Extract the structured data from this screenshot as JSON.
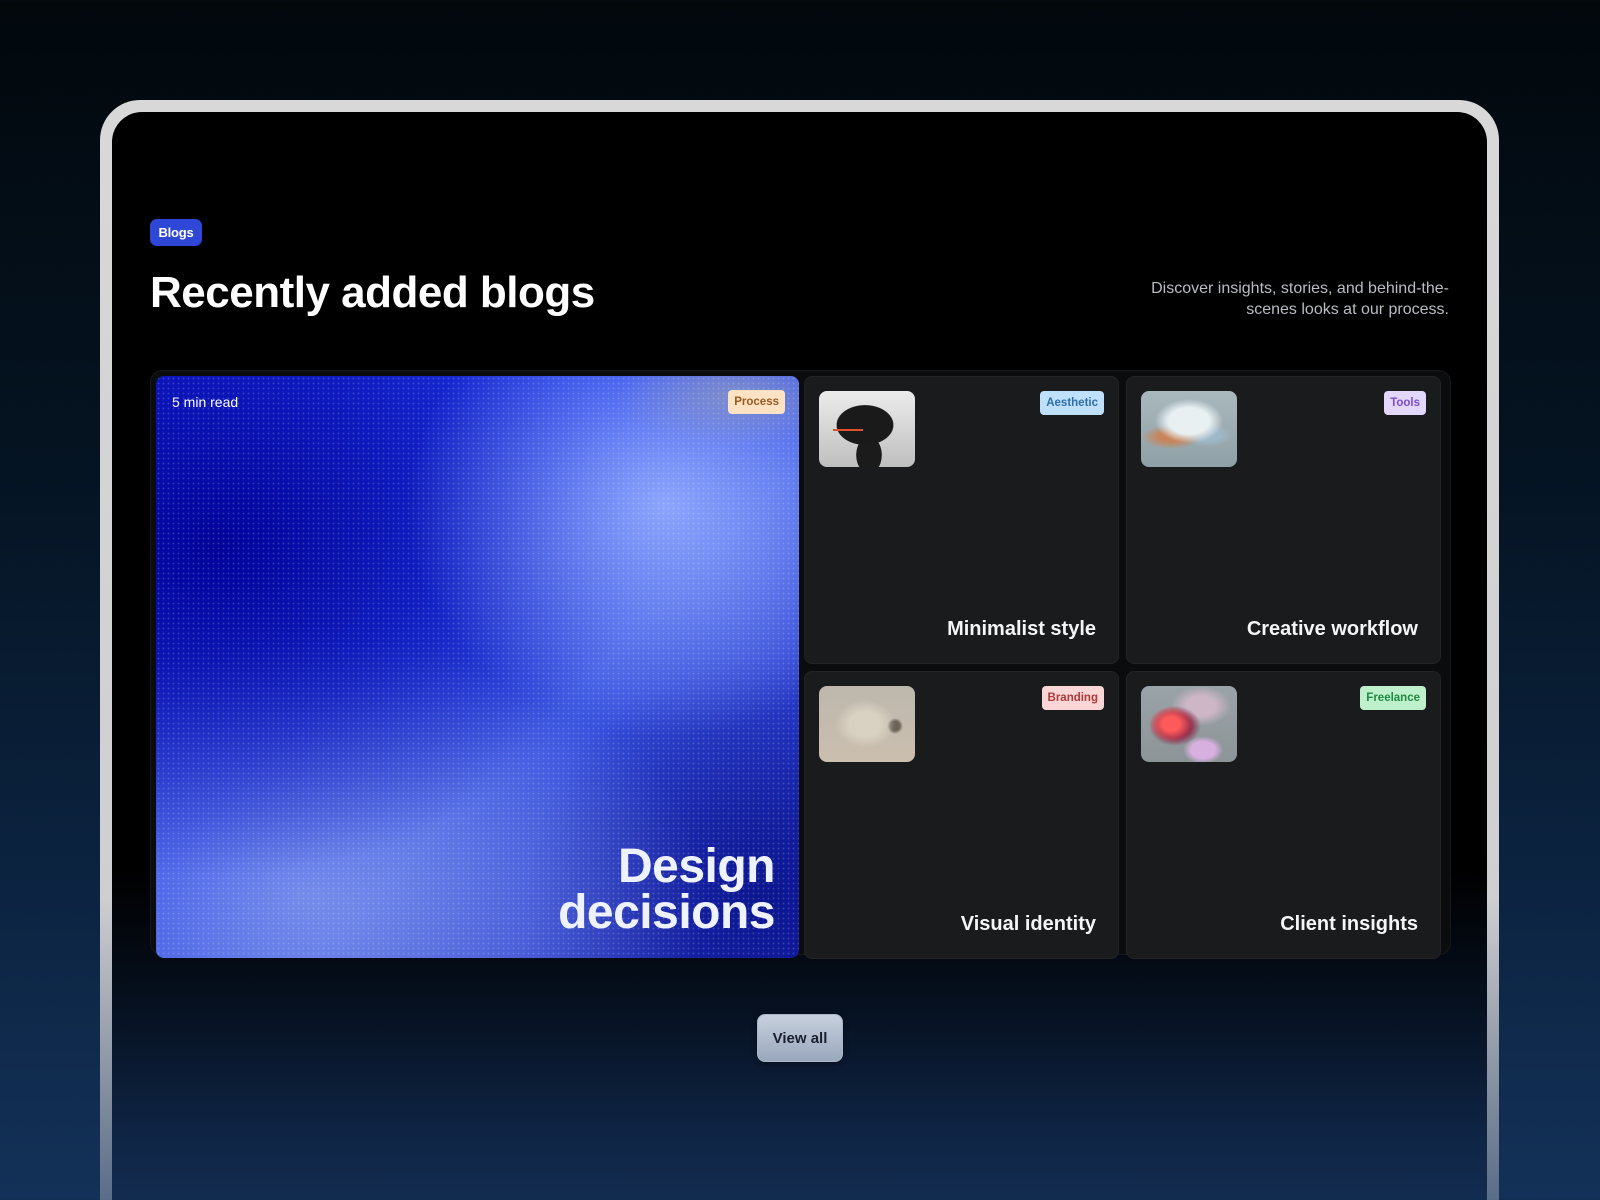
{
  "header": {
    "badge": "Blogs",
    "title": "Recently added blogs",
    "description": "Discover insights, stories, and behind-the-scenes looks at our process."
  },
  "featured": {
    "read_time": "5 min read",
    "tag": "Process",
    "title": "Design decisions"
  },
  "cards": [
    {
      "title": "Minimalist style",
      "tag": "Aesthetic",
      "thumbnail": "dark-helmet-image"
    },
    {
      "title": "Creative workflow",
      "tag": "Tools",
      "thumbnail": "iridescent-cloud-image"
    },
    {
      "title": "Visual identity",
      "tag": "Branding",
      "thumbnail": "transparent-camera-image"
    },
    {
      "title": "Client insights",
      "tag": "Freelance",
      "thumbnail": "glowing-particles-image"
    }
  ],
  "footer": {
    "view_all": "View all"
  },
  "colors": {
    "badge": "#2f47d6",
    "process_tag_bg": "#fde2c4",
    "aesthetic_tag_bg": "#bfe0fb",
    "tools_tag_bg": "#e3d7fb",
    "branding_tag_bg": "#fbd6d6",
    "freelance_tag_bg": "#bff0cc"
  }
}
